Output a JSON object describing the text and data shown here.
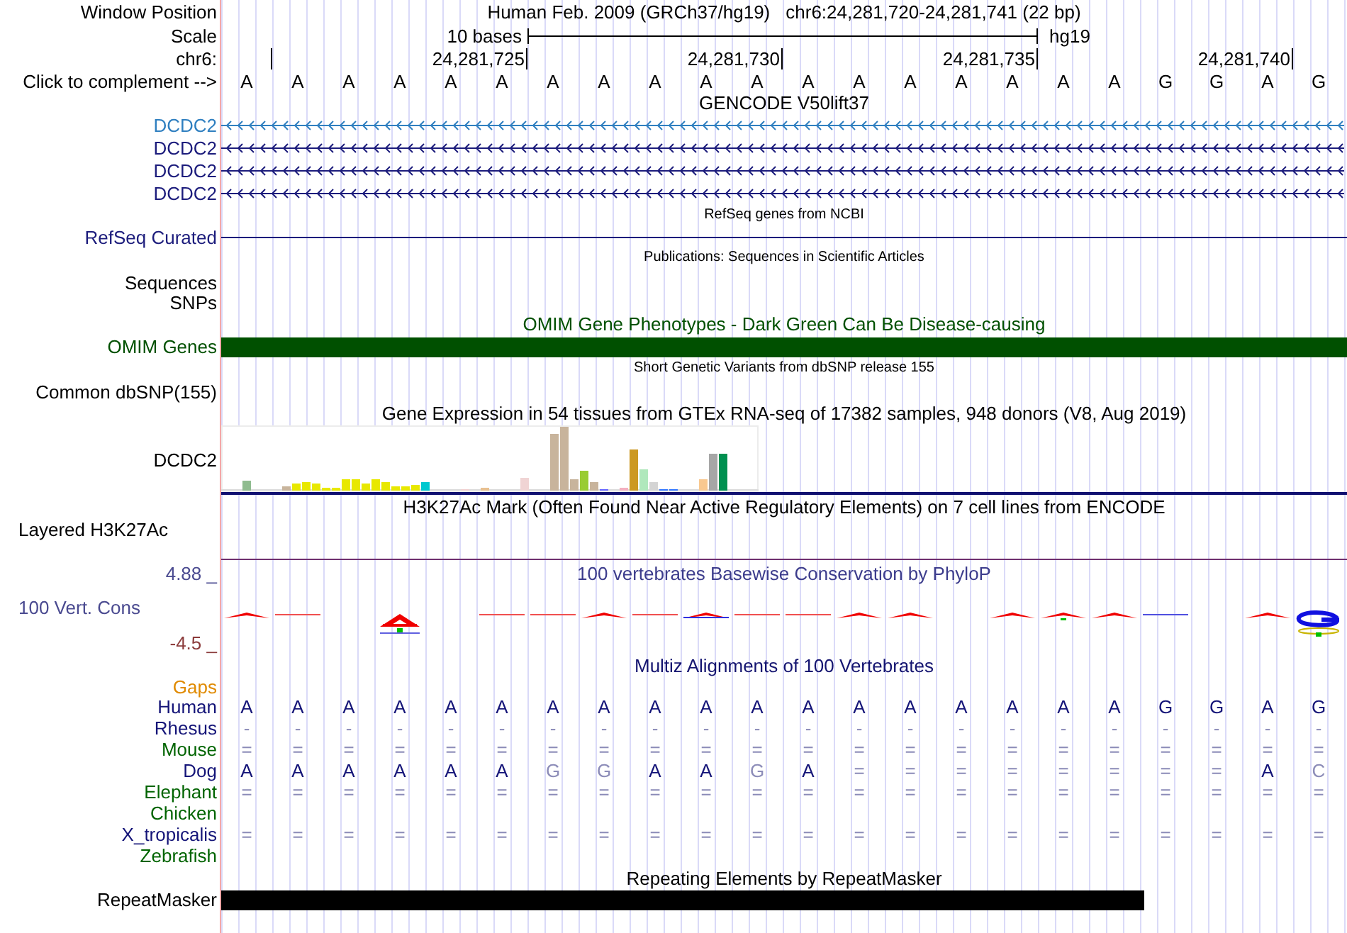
{
  "header": {
    "position_label": "Window Position",
    "assembly": "Human Feb. 2009 (GRCh37/hg19)",
    "position": "chr6:24,281,720-24,281,741 (22 bp)",
    "scale_label": "Scale",
    "scale_text": "10 bases",
    "scale_assembly": "hg19",
    "chrom_label": "chr6:",
    "ticks": [
      "24,281,725",
      "24,281,730",
      "24,281,735",
      "24,281,740"
    ]
  },
  "complement": {
    "label": "Click to complement -->",
    "bases": [
      "A",
      "A",
      "A",
      "A",
      "A",
      "A",
      "A",
      "A",
      "A",
      "A",
      "A",
      "A",
      "A",
      "A",
      "A",
      "A",
      "A",
      "A",
      "G",
      "G",
      "A",
      "G"
    ]
  },
  "tracks": [
    {
      "kind": "genes",
      "title": "GENCODE V50lift37",
      "items": [
        {
          "label": "DCDC2",
          "color": "#2f7fc0"
        },
        {
          "label": "DCDC2",
          "color": "#1c1c7c"
        },
        {
          "label": "DCDC2",
          "color": "#1c1c7c"
        },
        {
          "label": "DCDC2",
          "color": "#1c1c7c"
        }
      ]
    },
    {
      "kind": "refseq",
      "title": "RefSeq genes from NCBI",
      "rows": [
        {
          "label": "RefSeq Curated",
          "color": "#1c1c7c"
        }
      ]
    },
    {
      "kind": "annotation",
      "title": "Publications: Sequences in Scientific Articles",
      "rows": [
        {
          "label": "Sequences",
          "color": "#000000"
        },
        {
          "label": "SNPs",
          "color": "#000000"
        }
      ]
    },
    {
      "kind": "bar",
      "title": "OMIM Gene Phenotypes - Dark Green Can Be Disease-causing",
      "color": "#005000",
      "rows": [
        {
          "label": "OMIM Genes"
        }
      ]
    },
    {
      "kind": "annotation",
      "title": "Short Genetic Variants from dbSNP release 155",
      "rows": [
        {
          "label": "Common dbSNP(155)",
          "color": "#000000"
        }
      ]
    },
    {
      "kind": "expression",
      "title": "Gene Expression in 54 tissues from GTEx RNA-seq of 17382 samples, 948 donors (V8, Aug 2019)",
      "label": "DCDC2"
    },
    {
      "kind": "layered",
      "title": "H3K27Ac Mark (Often Found Near Active Regulatory Elements) on 7 cell lines from ENCODE",
      "label": "Layered H3K27Ac"
    },
    {
      "kind": "conservation",
      "title": "100 vertebrates Basewise Conservation by PhyloP",
      "label": "100 Vert. Cons",
      "max": "4.88 _",
      "min": "-4.5 _"
    },
    {
      "kind": "alignment",
      "title": "Multiz Alignments of 100 Vertebrates",
      "gaps_label": "Gaps",
      "species": [
        {
          "name": "Human",
          "color": "#141478",
          "bases": [
            "A",
            "A",
            "A",
            "A",
            "A",
            "A",
            "A",
            "A",
            "A",
            "A",
            "A",
            "A",
            "A",
            "A",
            "A",
            "A",
            "A",
            "A",
            "G",
            "G",
            "A",
            "G"
          ]
        },
        {
          "name": "Rhesus",
          "color": "#141478",
          "bases": [
            "-",
            "-",
            "-",
            "-",
            "-",
            "-",
            "-",
            "-",
            "-",
            "-",
            "-",
            "-",
            "-",
            "-",
            "-",
            "-",
            "-",
            "-",
            "-",
            "-",
            "-",
            "-"
          ]
        },
        {
          "name": "Mouse",
          "color": "#006400",
          "bases": [
            "=",
            "=",
            "=",
            "=",
            "=",
            "=",
            "=",
            "=",
            "=",
            "=",
            "=",
            "=",
            "=",
            "=",
            "=",
            "=",
            "=",
            "=",
            "=",
            "=",
            "=",
            "="
          ]
        },
        {
          "name": "Dog",
          "color": "#141478",
          "bases": [
            "A",
            "A",
            "A",
            "A",
            "A",
            "A",
            "G",
            "G",
            "A",
            "A",
            "G",
            "A",
            "=",
            "=",
            "=",
            "=",
            "=",
            "=",
            "=",
            "=",
            "A",
            "C"
          ]
        },
        {
          "name": "Elephant",
          "color": "#006400",
          "bases": [
            "=",
            "=",
            "=",
            "=",
            "=",
            "=",
            "=",
            "=",
            "=",
            "=",
            "=",
            "=",
            "=",
            "=",
            "=",
            "=",
            "=",
            "=",
            "=",
            "=",
            "=",
            "="
          ]
        },
        {
          "name": "Chicken",
          "color": "#006400"
        },
        {
          "name": "X_tropicalis",
          "color": "#141478",
          "bases": [
            "=",
            "=",
            "=",
            "=",
            "=",
            "=",
            "=",
            "=",
            "=",
            "=",
            "=",
            "=",
            "=",
            "=",
            "=",
            "=",
            "=",
            "=",
            "=",
            "=",
            "=",
            "="
          ]
        },
        {
          "name": "Zebrafish",
          "color": "#006400"
        }
      ]
    },
    {
      "kind": "bar",
      "title": "Repeating Elements by RepeatMasker",
      "color": "#000000",
      "rows": [
        {
          "label": "RepeatMasker"
        }
      ]
    }
  ]
}
